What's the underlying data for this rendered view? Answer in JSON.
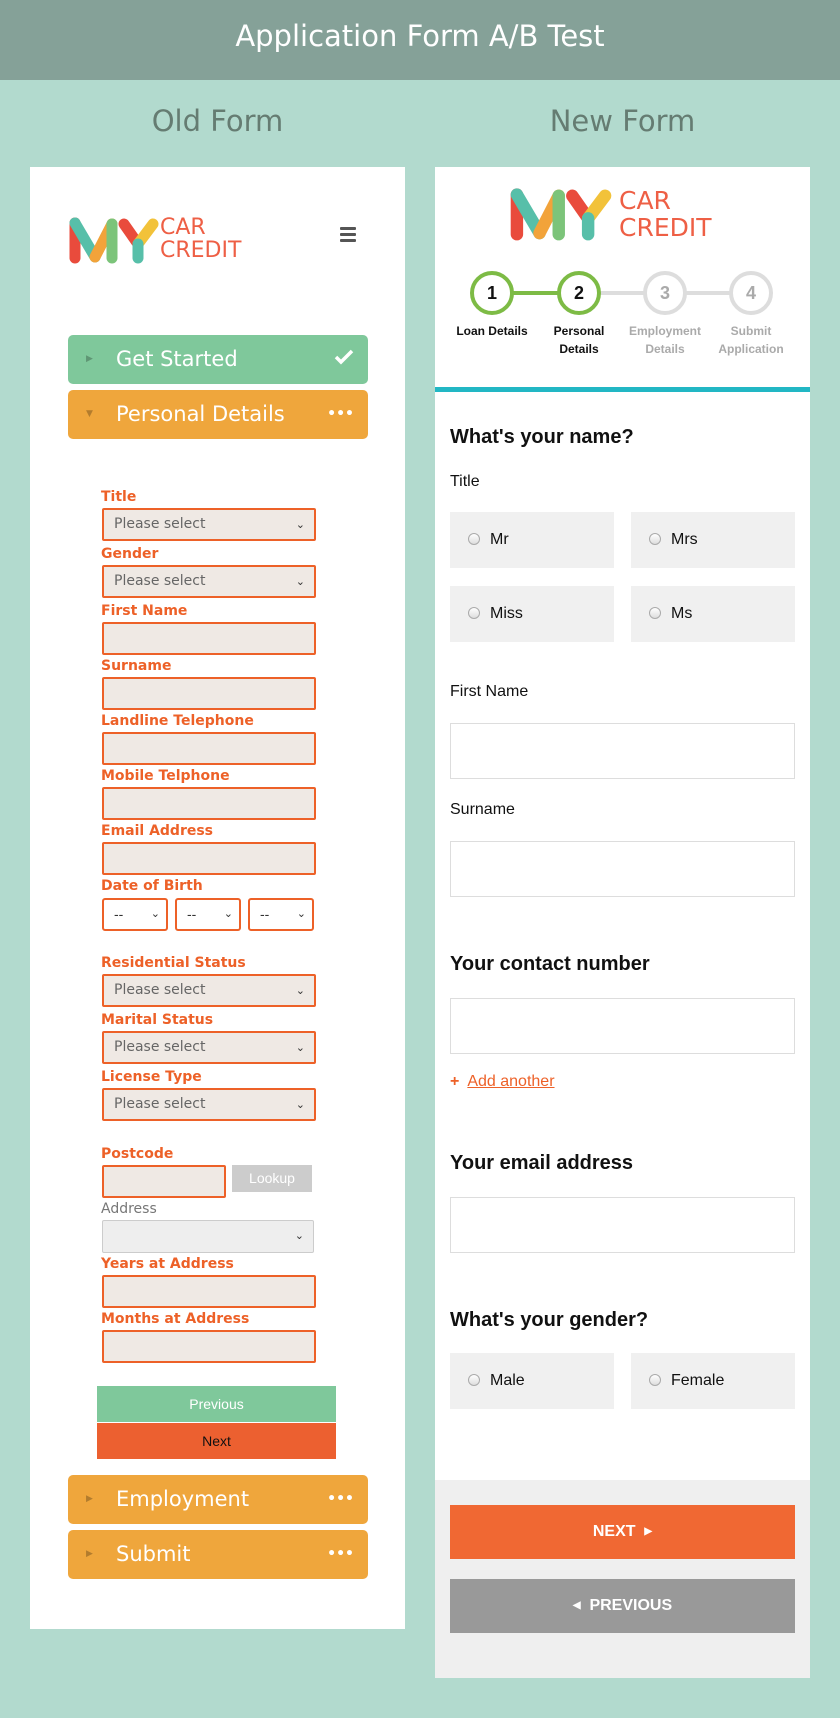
{
  "page": {
    "banner_title": "Application Form A/B Test",
    "old_title": "Old Form",
    "new_title": "New Form"
  },
  "logo": {
    "line1": "CAR",
    "line2": "CREDIT"
  },
  "colors": {
    "accent_orange": "#ed6128",
    "accordion_green": "#7fc89b",
    "accordion_orange": "#efa63c",
    "step_green": "#7dbb45",
    "progress_teal": "#22b7c4"
  },
  "old_form": {
    "menu_icon": "hamburger-icon",
    "sections": [
      {
        "label": "Get Started",
        "status": "check-icon"
      },
      {
        "label": "Personal Details",
        "status": "ellipsis-icon"
      },
      {
        "label": "Employment",
        "status": "ellipsis-icon"
      },
      {
        "label": "Submit",
        "status": "ellipsis-icon"
      }
    ],
    "status_ellipsis": "•••",
    "select_placeholder": "Please select",
    "fields": {
      "title": "Title",
      "gender": "Gender",
      "first_name": "First Name",
      "surname": "Surname",
      "landline": "Landline Telephone",
      "mobile": "Mobile Telphone",
      "email": "Email Address",
      "dob": "Date of Birth",
      "dob_placeholder": "--",
      "residential": "Residential Status",
      "marital": "Marital Status",
      "license": "License Type",
      "postcode": "Postcode",
      "lookup": "Lookup",
      "address": "Address",
      "years": "Years at Address",
      "months": "Months at Address"
    },
    "buttons": {
      "previous": "Previous",
      "next": "Next"
    }
  },
  "new_form": {
    "steps": [
      {
        "number": "1",
        "label1": "Loan Details",
        "label2": "",
        "state": "done"
      },
      {
        "number": "2",
        "label1": "Personal",
        "label2": "Details",
        "state": "current"
      },
      {
        "number": "3",
        "label1": "Employment",
        "label2": "Details",
        "state": "todo"
      },
      {
        "number": "4",
        "label1": "Submit",
        "label2": "Application",
        "state": "todo"
      }
    ],
    "name_heading": "What's your name?",
    "title_label": "Title",
    "title_options": [
      "Mr",
      "Mrs",
      "Miss",
      "Ms"
    ],
    "first_name_label": "First Name",
    "surname_label": "Surname",
    "contact_heading": "Your contact number",
    "add_another": "Add another",
    "add_plus": "+",
    "email_heading": "Your email address",
    "gender_heading": "What's your gender?",
    "gender_options": [
      "Male",
      "Female"
    ],
    "next_button": "NEXT",
    "previous_button": "PREVIOUS",
    "arrow_right": "▶",
    "arrow_left": "◀"
  }
}
